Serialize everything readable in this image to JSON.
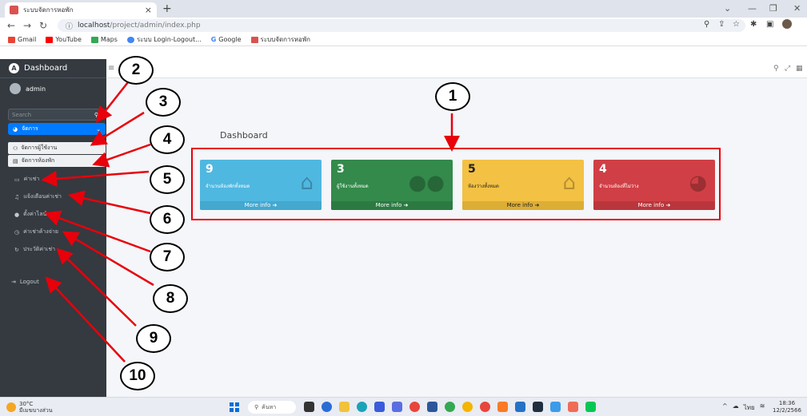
{
  "browser": {
    "tab_title": "ระบบจัดการหอพัก",
    "tab_close": "×",
    "new_tab": "+",
    "url_host": "localhost",
    "url_path": "/project/admin/index.php",
    "bookmarks": [
      {
        "label": "Gmail",
        "color": "#ea4335"
      },
      {
        "label": "YouTube",
        "color": "#ff0000"
      },
      {
        "label": "Maps",
        "color": "#34a853"
      },
      {
        "label": "ระบบ Login-Logout...",
        "color": "#4285f4"
      },
      {
        "label": "Google",
        "color": "#4285f4"
      },
      {
        "label": "ระบบจัดการหอพัก",
        "color": "#d9534f"
      }
    ]
  },
  "sidebar": {
    "brand": "Dashboard",
    "brand_logo": "A",
    "user": "admin",
    "search_placeholder": "Search",
    "main_item": "จัดการ",
    "sub_items": [
      "จัดการผู้ใช้งาน",
      "จัดการห้องพัก"
    ],
    "items": [
      "ค่าเช่า",
      "แจ้งเตือนค่าเช่า",
      "ตั้งค่าไลน์",
      "ค่าเช่าค้างจ่าย",
      "ประวัติค่าเช่า"
    ],
    "logout": "Logout"
  },
  "main": {
    "page_title": "Dashboard",
    "boxes": [
      {
        "number": "9",
        "label": "จำนวนห้องพักทั้งหมด",
        "more": "More info",
        "color": "#4fb8e0",
        "footer": "#44a8cf",
        "icon": "home-icon"
      },
      {
        "number": "3",
        "label": "ผู้ใช้งานทั้งหมด",
        "more": "More info",
        "color": "#338a4b",
        "footer": "#2c7a42",
        "icon": "users-icon"
      },
      {
        "number": "5",
        "label": "ห้องว่างทั้งหมด",
        "more": "More info",
        "color": "#f3c143",
        "footer": "#dcae35",
        "icon": "home-plus-icon"
      },
      {
        "number": "4",
        "label": "จำนวนห้องที่ไม่ว่าง",
        "more": "More info",
        "color": "#d03f45",
        "footer": "#b9363c",
        "icon": "pie-chart-icon"
      }
    ]
  },
  "callouts": [
    "1",
    "2",
    "3",
    "4",
    "5",
    "6",
    "7",
    "8",
    "9",
    "10"
  ],
  "taskbar": {
    "temp": "30°C",
    "weather_text": "มีเมฆบางส่วน",
    "search": "ค้นหา",
    "lang": "ไทย",
    "time": "18:36",
    "date": "12/2/2566"
  },
  "colors": {
    "sidebar": "#343a40",
    "accent": "#007bff",
    "callout_arrow": "#e8000b"
  }
}
